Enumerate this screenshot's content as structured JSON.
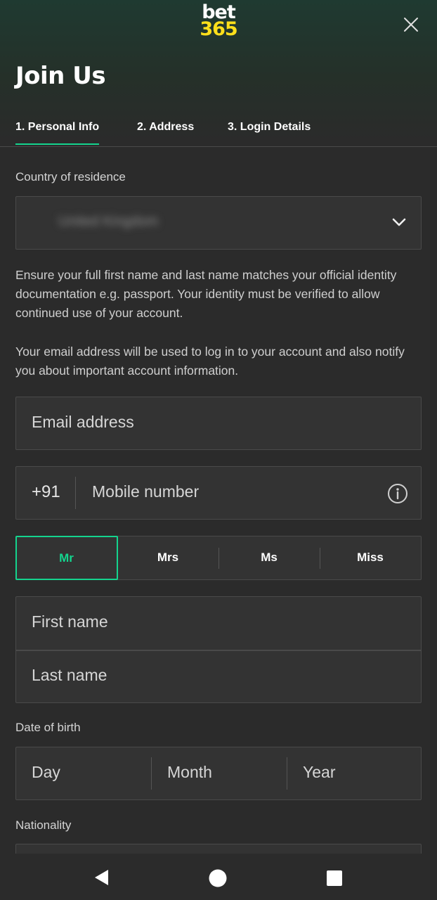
{
  "header": {
    "logo_line1": "bet",
    "logo_line2": "365",
    "close_icon": "close-icon",
    "title": "Join Us"
  },
  "tabs": [
    {
      "label": "1.  Personal Info",
      "active": true
    },
    {
      "label": "2.  Address",
      "active": false
    },
    {
      "label": "3.  Login Details",
      "active": false
    }
  ],
  "country": {
    "label": "Country of residence",
    "value": "United Kingdom",
    "icon": "chevron-down-icon"
  },
  "notices": {
    "identity": "Ensure your full first name and last name matches your official identity documentation e.g. passport. Your identity must be verified to allow continued use of your account.",
    "email": "Your email address will be used to log in to your account and also notify you about important account information."
  },
  "email": {
    "placeholder": "Email address"
  },
  "mobile": {
    "prefix": "+91",
    "placeholder": "Mobile number",
    "icon": "info-icon"
  },
  "titles": {
    "options": [
      "Mr",
      "Mrs",
      "Ms",
      "Miss"
    ],
    "selected": "Mr"
  },
  "name": {
    "first_placeholder": "First name",
    "last_placeholder": "Last name"
  },
  "dob": {
    "label": "Date of birth",
    "day": "Day",
    "month": "Month",
    "year": "Year"
  },
  "nationality": {
    "label": "Nationality"
  },
  "navbar": {
    "back_icon": "back-triangle-icon",
    "home_icon": "home-circle-icon",
    "recents_icon": "recents-square-icon"
  },
  "colors": {
    "accent": "#14d48e",
    "logo_yellow": "#ffdf1b",
    "background": "#2b2b2b"
  }
}
